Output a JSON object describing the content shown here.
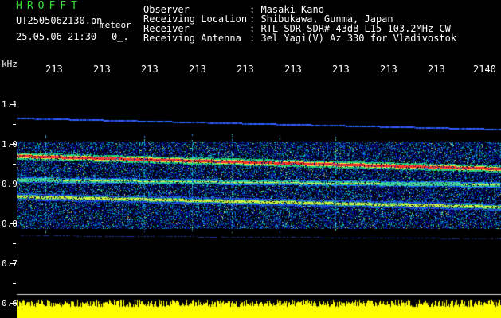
{
  "header": {
    "brand": "HROFFT",
    "filename": "UT2505062130.pn",
    "filename_tag": "meteor",
    "datetime": "25.05.06 21:30",
    "index": "0_.",
    "rows": [
      {
        "label": "Observer",
        "value": ": Masaki Kano"
      },
      {
        "label": "Receiving Location",
        "value": ": Shibukawa, Gunma, Japan"
      },
      {
        "label": "Receiver",
        "value": ": RTL-SDR SDR# 43dB L15 103.2MHz CW"
      },
      {
        "label": "Receiving Antenna",
        "value": ": 3el Yagi(V) Az 330 for Vladivostok"
      }
    ]
  },
  "time_axis": {
    "labels": [
      "213",
      "213",
      "213",
      "213",
      "213",
      "213",
      "213",
      "213",
      "213",
      "2140"
    ]
  },
  "freq_axis": {
    "unit": "kHz",
    "labels": [
      "1.1",
      "1.0",
      "0.9",
      "0.8",
      "0.7",
      "0.6"
    ]
  },
  "colors": {
    "header_text": "#ffffff",
    "brand": "#38e038",
    "background": "#000000",
    "noise": "#ffff00",
    "carrier": "#ff3030"
  }
}
